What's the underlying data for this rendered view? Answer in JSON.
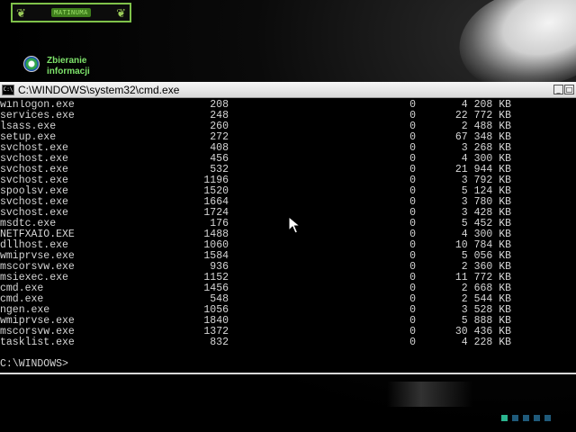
{
  "desktop": {
    "banner_text": "MATINUMA",
    "icon_label": "Zbieranie informacji"
  },
  "window": {
    "title": "C:\\WINDOWS\\system32\\cmd.exe",
    "icon_text": "C:\\"
  },
  "processes": [
    {
      "name": "winlogon.exe",
      "pid": "208",
      "session": "0",
      "mem": "4 208 KB"
    },
    {
      "name": "services.exe",
      "pid": "248",
      "session": "0",
      "mem": "22 772 KB"
    },
    {
      "name": "lsass.exe",
      "pid": "260",
      "session": "0",
      "mem": "2 488 KB"
    },
    {
      "name": "setup.exe",
      "pid": "272",
      "session": "0",
      "mem": "67 348 KB"
    },
    {
      "name": "svchost.exe",
      "pid": "408",
      "session": "0",
      "mem": "3 268 KB"
    },
    {
      "name": "svchost.exe",
      "pid": "456",
      "session": "0",
      "mem": "4 300 KB"
    },
    {
      "name": "svchost.exe",
      "pid": "532",
      "session": "0",
      "mem": "21 944 KB"
    },
    {
      "name": "svchost.exe",
      "pid": "1196",
      "session": "0",
      "mem": "3 792 KB"
    },
    {
      "name": "spoolsv.exe",
      "pid": "1520",
      "session": "0",
      "mem": "5 124 KB"
    },
    {
      "name": "svchost.exe",
      "pid": "1664",
      "session": "0",
      "mem": "3 780 KB"
    },
    {
      "name": "svchost.exe",
      "pid": "1724",
      "session": "0",
      "mem": "3 428 KB"
    },
    {
      "name": "msdtc.exe",
      "pid": "176",
      "session": "0",
      "mem": "5 452 KB"
    },
    {
      "name": "NETFXAIO.EXE",
      "pid": "1488",
      "session": "0",
      "mem": "4 300 KB"
    },
    {
      "name": "dllhost.exe",
      "pid": "1060",
      "session": "0",
      "mem": "10 784 KB"
    },
    {
      "name": "wmiprvse.exe",
      "pid": "1584",
      "session": "0",
      "mem": "5 056 KB"
    },
    {
      "name": "mscorsvw.exe",
      "pid": "936",
      "session": "0",
      "mem": "2 360 KB"
    },
    {
      "name": "msiexec.exe",
      "pid": "1152",
      "session": "0",
      "mem": "11 772 KB"
    },
    {
      "name": "cmd.exe",
      "pid": "1456",
      "session": "0",
      "mem": "2 668 KB"
    },
    {
      "name": "cmd.exe",
      "pid": "548",
      "session": "0",
      "mem": "2 544 KB"
    },
    {
      "name": "ngen.exe",
      "pid": "1056",
      "session": "0",
      "mem": "3 528 KB"
    },
    {
      "name": "wmiprvse.exe",
      "pid": "1840",
      "session": "0",
      "mem": "5 888 KB"
    },
    {
      "name": "mscorsvw.exe",
      "pid": "1372",
      "session": "0",
      "mem": "30 436 KB"
    },
    {
      "name": "tasklist.exe",
      "pid": "832",
      "session": "0",
      "mem": "4 228 KB"
    }
  ],
  "prompt": "C:\\WINDOWS>",
  "colors": {
    "console_bg": "#000000",
    "console_text": "#d6d6d6",
    "banner_border": "#7fc24a",
    "icon_label": "#7ee36b"
  }
}
